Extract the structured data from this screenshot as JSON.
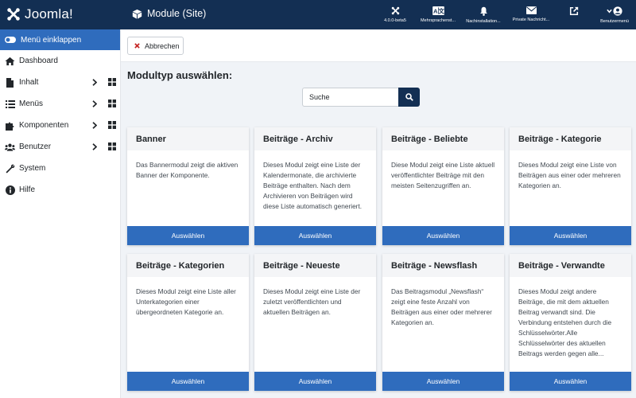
{
  "app": {
    "brand": "Joomla!",
    "page_title": "Module (Site)"
  },
  "header": {
    "items": [
      {
        "label": "4.0.0-beta5",
        "icon": "joomla-icon"
      },
      {
        "label": "Mehrsprachenst...",
        "icon": "language-icon"
      },
      {
        "label": "Nachinstallation...",
        "icon": "bell-icon"
      },
      {
        "label": "Private Nachricht...",
        "icon": "envelope-icon"
      },
      {
        "label": "",
        "icon": "external-link-icon"
      },
      {
        "label": "Benutzermenü",
        "icon": "user-icon"
      }
    ]
  },
  "sidebar": {
    "collapse_label": "Menü einklappen",
    "items": [
      {
        "label": "Dashboard",
        "icon": "home-icon"
      },
      {
        "label": "Inhalt",
        "icon": "file-icon"
      },
      {
        "label": "Menüs",
        "icon": "list-icon"
      },
      {
        "label": "Komponenten",
        "icon": "puzzle-icon"
      },
      {
        "label": "Benutzer",
        "icon": "users-icon"
      },
      {
        "label": "System",
        "icon": "wrench-icon"
      },
      {
        "label": "Hilfe",
        "icon": "info-icon"
      }
    ]
  },
  "toolbar": {
    "cancel_label": "Abbrechen"
  },
  "main": {
    "title": "Modultyp auswählen:",
    "search_placeholder": "Suche"
  },
  "cards": [
    {
      "title": "Banner",
      "description": "Das Bannermodul zeigt die aktiven Banner der Komponente.",
      "button": "Auswählen"
    },
    {
      "title": "Beiträge - Archiv",
      "description": "Dieses Modul zeigt eine Liste der Kalendermonate, die archivierte Beiträge enthalten. Nach dem Archivieren von Beiträgen wird diese Liste automatisch generiert.",
      "button": "Auswählen"
    },
    {
      "title": "Beiträge - Beliebte",
      "description": "Diese Modul zeigt eine Liste aktuell veröffentlichter Beiträge mit den meisten Seitenzugriffen an.",
      "button": "Auswählen"
    },
    {
      "title": "Beiträge - Kategorie",
      "description": "Dieses Modul zeigt eine Liste von Beiträgen aus einer oder mehreren Kategorien an.",
      "button": "Auswählen"
    },
    {
      "title": "Beiträge - Kategorien",
      "description": "Dieses Modul zeigt eine Liste aller Unterkategorien einer übergeordneten Kategorie an.",
      "button": "Auswählen"
    },
    {
      "title": "Beiträge - Neueste",
      "description": "Dieses Modul zeigt eine Liste der zuletzt veröffentlichten und aktuellen Beiträgen an.",
      "button": "Auswählen"
    },
    {
      "title": "Beiträge - Newsflash",
      "description": "Das Beitragsmodul „Newsflash“ zeigt eine feste Anzahl von Beiträgen aus einer oder mehrerer Kategorien an.",
      "button": "Auswählen"
    },
    {
      "title": "Beiträge - Verwandte",
      "description": "Dieses Modul zeigt andere Beiträge, die mit dem aktuellen Beitrag verwandt sind. Die Verbindung entstehen durch die Schlüsselwörter.Alle Schlüsselwörter des aktuellen Beitrags werden gegen alle...",
      "button": "Auswählen"
    }
  ],
  "colors": {
    "header_bg": "#132f53",
    "accent": "#2f6cbd",
    "page_bg": "#f0f3f7"
  }
}
